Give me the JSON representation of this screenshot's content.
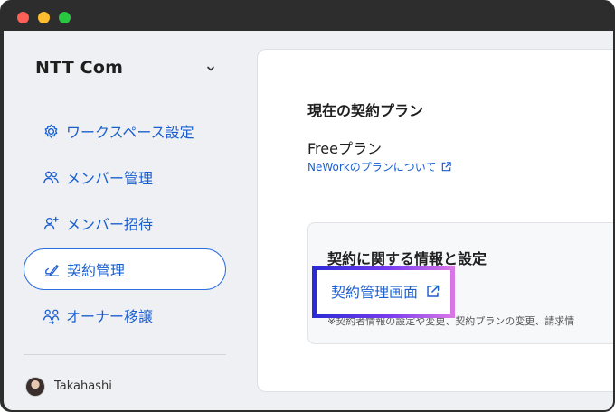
{
  "window": {
    "controls": [
      "close",
      "minimize",
      "zoom"
    ]
  },
  "sidebar": {
    "workspace_name": "NTT Com",
    "items": [
      {
        "label": "ワークスペース設定",
        "icon": "gear-icon",
        "active": false
      },
      {
        "label": "メンバー管理",
        "icon": "users-icon",
        "active": false
      },
      {
        "label": "メンバー招待",
        "icon": "user-plus-icon",
        "active": false
      },
      {
        "label": "契約管理",
        "icon": "contract-icon",
        "active": true
      },
      {
        "label": "オーナー移譲",
        "icon": "transfer-owner-icon",
        "active": false
      }
    ],
    "user": {
      "name": "Takahashi"
    }
  },
  "main": {
    "plan_heading": "現在の契約プラン",
    "plan_name": "Freeプラン",
    "plan_link": "NeWorkのプランについて",
    "contract_info": {
      "heading": "契約に関する情報と設定",
      "link_label": "契約管理画面",
      "note": "※契約者情報の設定や変更、契約プランの変更、請求情"
    }
  },
  "colors": {
    "accent": "#1a5fd0",
    "active_border": "#2f6fe0",
    "highlight_gradient": [
      "#2d2bd6",
      "#7a3cf0",
      "#d876e6"
    ]
  }
}
